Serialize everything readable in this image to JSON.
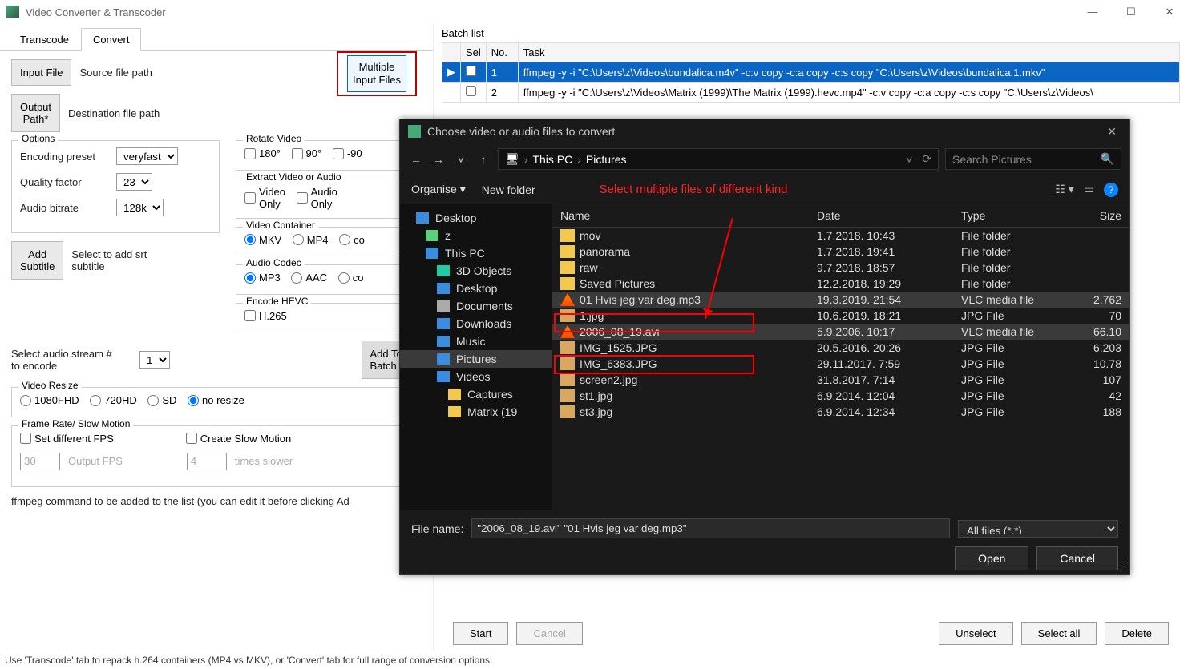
{
  "app": {
    "title": "Video Converter & Transcoder"
  },
  "tabs": {
    "transcode": "Transcode",
    "convert": "Convert"
  },
  "left": {
    "input_file_btn": "Input File",
    "src_label": "Source file path",
    "output_path_btn": "Output\nPath*",
    "dest_label": "Destination file path",
    "multiple_btn": "Multiple\nInput Files",
    "rotate_title": "Rotate Video",
    "rot180": "180°",
    "rot90": "90°",
    "rotm90": "-90",
    "extract_title": "Extract Video or Audio",
    "video_only": "Video\nOnly",
    "audio_only": "Audio\nOnly",
    "options_title": "Options",
    "enc_preset_lbl": "Encoding preset",
    "enc_preset_val": "veryfast",
    "quality_lbl": "Quality factor",
    "quality_val": "23",
    "abitrate_lbl": "Audio bitrate",
    "abitrate_val": "128k",
    "add_sub_btn": "Add\nSubtitle",
    "add_sub_lbl": "Select to add srt subtitle",
    "container_title": "Video Container",
    "mkv": "MKV",
    "mp4": "MP4",
    "copy_c": "co",
    "acodec_title": "Audio Codec",
    "mp3": "MP3",
    "aac": "AAC",
    "copy_a": "co",
    "hevc_title": "Encode HEVC",
    "h265": "H.265",
    "audio_stream_lbl": "Select audio stream #\nto encode",
    "audio_stream_val": "1",
    "add_batch_btn": "Add To\nBatch Lis",
    "resize_title": "Video Resize",
    "r1080": "1080FHD",
    "r720": "720HD",
    "rsd": "SD",
    "rnone": "no resize",
    "fps_title": "Frame Rate/ Slow Motion",
    "set_fps": "Set different FPS",
    "create_slow": "Create Slow Motion",
    "fps_val": "30",
    "fps_hint": "Output FPS",
    "slow_val": "4",
    "slow_hint": "times slower",
    "cmd_lbl": "ffmpeg command to be added to the list (you can edit it before clicking Ad"
  },
  "batch": {
    "title": "Batch list",
    "cols": {
      "sel": "Sel",
      "no": "No.",
      "task": "Task"
    },
    "rows": [
      {
        "no": "1",
        "task": "ffmpeg -y -i \"C:\\Users\\z\\Videos\\bundalica.m4v\" -c:v copy -c:a copy -c:s copy \"C:\\Users\\z\\Videos\\bundalica.1.mkv\"",
        "sel": true
      },
      {
        "no": "2",
        "task": "ffmpeg -y -i \"C:\\Users\\z\\Videos\\Matrix (1999)\\The Matrix (1999).hevc.mp4\" -c:v copy -c:a copy -c:s copy \"C:\\Users\\z\\Videos\\",
        "sel": false
      }
    ]
  },
  "footer": {
    "start": "Start",
    "cancel": "Cancel",
    "unselect": "Unselect",
    "select_all": "Select all",
    "delete": "Delete"
  },
  "status": "Use 'Transcode' tab to repack h.264 containers (MP4 vs MKV), or 'Convert' tab for full range of conversion options.",
  "dialog": {
    "title": "Choose video or audio files to convert",
    "bc1": "This PC",
    "bc2": "Pictures",
    "search_ph": "Search Pictures",
    "organise": "Organise ▾",
    "new_folder": "New folder",
    "annot": "Select multiple files of different kind",
    "cols": {
      "name": "Name",
      "date": "Date",
      "type": "Type",
      "size": "Size"
    },
    "tree": [
      {
        "icon": "desktop",
        "label": "Desktop",
        "indent": false
      },
      {
        "icon": "user",
        "label": "z",
        "indent": true
      },
      {
        "icon": "pc",
        "label": "This PC",
        "indent": true
      },
      {
        "icon": "obj3d",
        "label": "3D Objects",
        "indent": true,
        "deep": true
      },
      {
        "icon": "desktop",
        "label": "Desktop",
        "indent": true,
        "deep": true
      },
      {
        "icon": "docs",
        "label": "Documents",
        "indent": true,
        "deep": true
      },
      {
        "icon": "dl",
        "label": "Downloads",
        "indent": true,
        "deep": true
      },
      {
        "icon": "music",
        "label": "Music",
        "indent": true,
        "deep": true
      },
      {
        "icon": "pic",
        "label": "Pictures",
        "indent": true,
        "deep": true,
        "sel": true
      },
      {
        "icon": "vid",
        "label": "Videos",
        "indent": true,
        "deep": true
      },
      {
        "icon": "folder",
        "label": "Captures",
        "indent": true,
        "deep": true,
        "deeper": true
      },
      {
        "icon": "folder",
        "label": "Matrix (19",
        "indent": true,
        "deep": true,
        "deeper": true
      }
    ],
    "files": [
      {
        "icon": "folder",
        "name": "mov",
        "date": "1.7.2018. 10:43",
        "type": "File folder",
        "size": ""
      },
      {
        "icon": "folder",
        "name": "panorama",
        "date": "1.7.2018. 19:41",
        "type": "File folder",
        "size": ""
      },
      {
        "icon": "folder",
        "name": "raw",
        "date": "9.7.2018. 18:57",
        "type": "File folder",
        "size": ""
      },
      {
        "icon": "folder",
        "name": "Saved Pictures",
        "date": "12.2.2018. 19:29",
        "type": "File folder",
        "size": ""
      },
      {
        "icon": "vlc",
        "name": "01 Hvis jeg var deg.mp3",
        "date": "19.3.2019. 21:54",
        "type": "VLC media file",
        "size": "2.762",
        "sel": true,
        "box": true
      },
      {
        "icon": "img",
        "name": "1.jpg",
        "date": "10.6.2019. 18:21",
        "type": "JPG File",
        "size": "70"
      },
      {
        "icon": "vlc",
        "name": "2006_08_19.avi",
        "date": "5.9.2006. 10:17",
        "type": "VLC media file",
        "size": "66.10",
        "sel": true,
        "box": true
      },
      {
        "icon": "img",
        "name": "IMG_1525.JPG",
        "date": "20.5.2016. 20:26",
        "type": "JPG File",
        "size": "6.203"
      },
      {
        "icon": "img",
        "name": "IMG_6383.JPG",
        "date": "29.11.2017. 7:59",
        "type": "JPG File",
        "size": "10.78"
      },
      {
        "icon": "img",
        "name": "screen2.jpg",
        "date": "31.8.2017. 7:14",
        "type": "JPG File",
        "size": "107"
      },
      {
        "icon": "img",
        "name": "st1.jpg",
        "date": "6.9.2014. 12:04",
        "type": "JPG File",
        "size": "42"
      },
      {
        "icon": "img",
        "name": "st3.jpg",
        "date": "6.9.2014. 12:34",
        "type": "JPG File",
        "size": "188"
      }
    ],
    "fn_label": "File name:",
    "fn_value": "\"2006_08_19.avi\" \"01 Hvis jeg var deg.mp3\"",
    "filter": "All files (*.*)",
    "open": "Open",
    "cancel": "Cancel"
  }
}
